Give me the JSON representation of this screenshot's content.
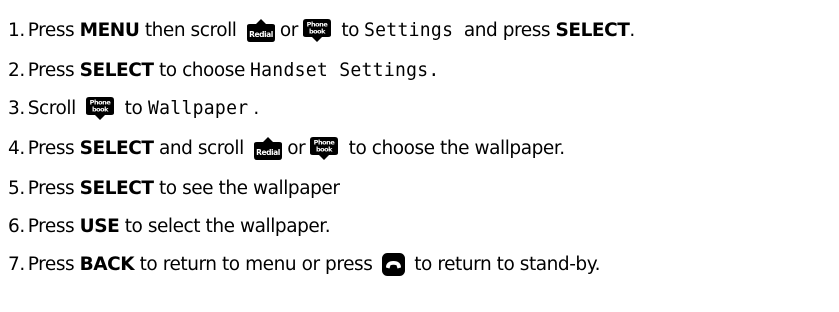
{
  "icons": {
    "redial_key": "redial-up-arrow-key-icon",
    "phonebook_key": "phonebook-down-arrow-key-icon",
    "end_call_key": "end-call-phone-key-icon"
  },
  "colors": {
    "text": "#000000",
    "key_fill": "#000000",
    "key_text": "#ffffff"
  },
  "key_labels": {
    "redial": "Redial",
    "phone": "Phone",
    "book": "book"
  },
  "steps": [
    {
      "num": "1.",
      "t1": "Press ",
      "b1": "MENU",
      "t2": " then scroll ",
      "or": "or",
      "t3": " to ",
      "lcd": "Settings",
      "t4": " and press ",
      "b2": "SELECT",
      "t5": "."
    },
    {
      "num": "2.",
      "t1": "Press ",
      "b1": "SELECT",
      "t2": " to choose ",
      "lcd": "Handset Settings."
    },
    {
      "num": "3.",
      "t1": "Scroll ",
      "t2": " to ",
      "lcd": "Wallpaper",
      "t3": "."
    },
    {
      "num": "4.",
      "t1": "Press ",
      "b1": "SELECT",
      "t2": " and scroll ",
      "or": "or",
      "t3": " to choose the wallpaper."
    },
    {
      "num": "5.",
      "t1": "Press ",
      "b1": "SELECT",
      "t2": " to see the wallpaper"
    },
    {
      "num": "6.",
      "t1": "Press ",
      "b1": "USE",
      "t2": " to select the wallpaper."
    },
    {
      "num": "7.",
      "t1": "Press ",
      "b1": "BACK",
      "t2": " to return to menu or press ",
      "t3": " to return to stand-by."
    }
  ]
}
